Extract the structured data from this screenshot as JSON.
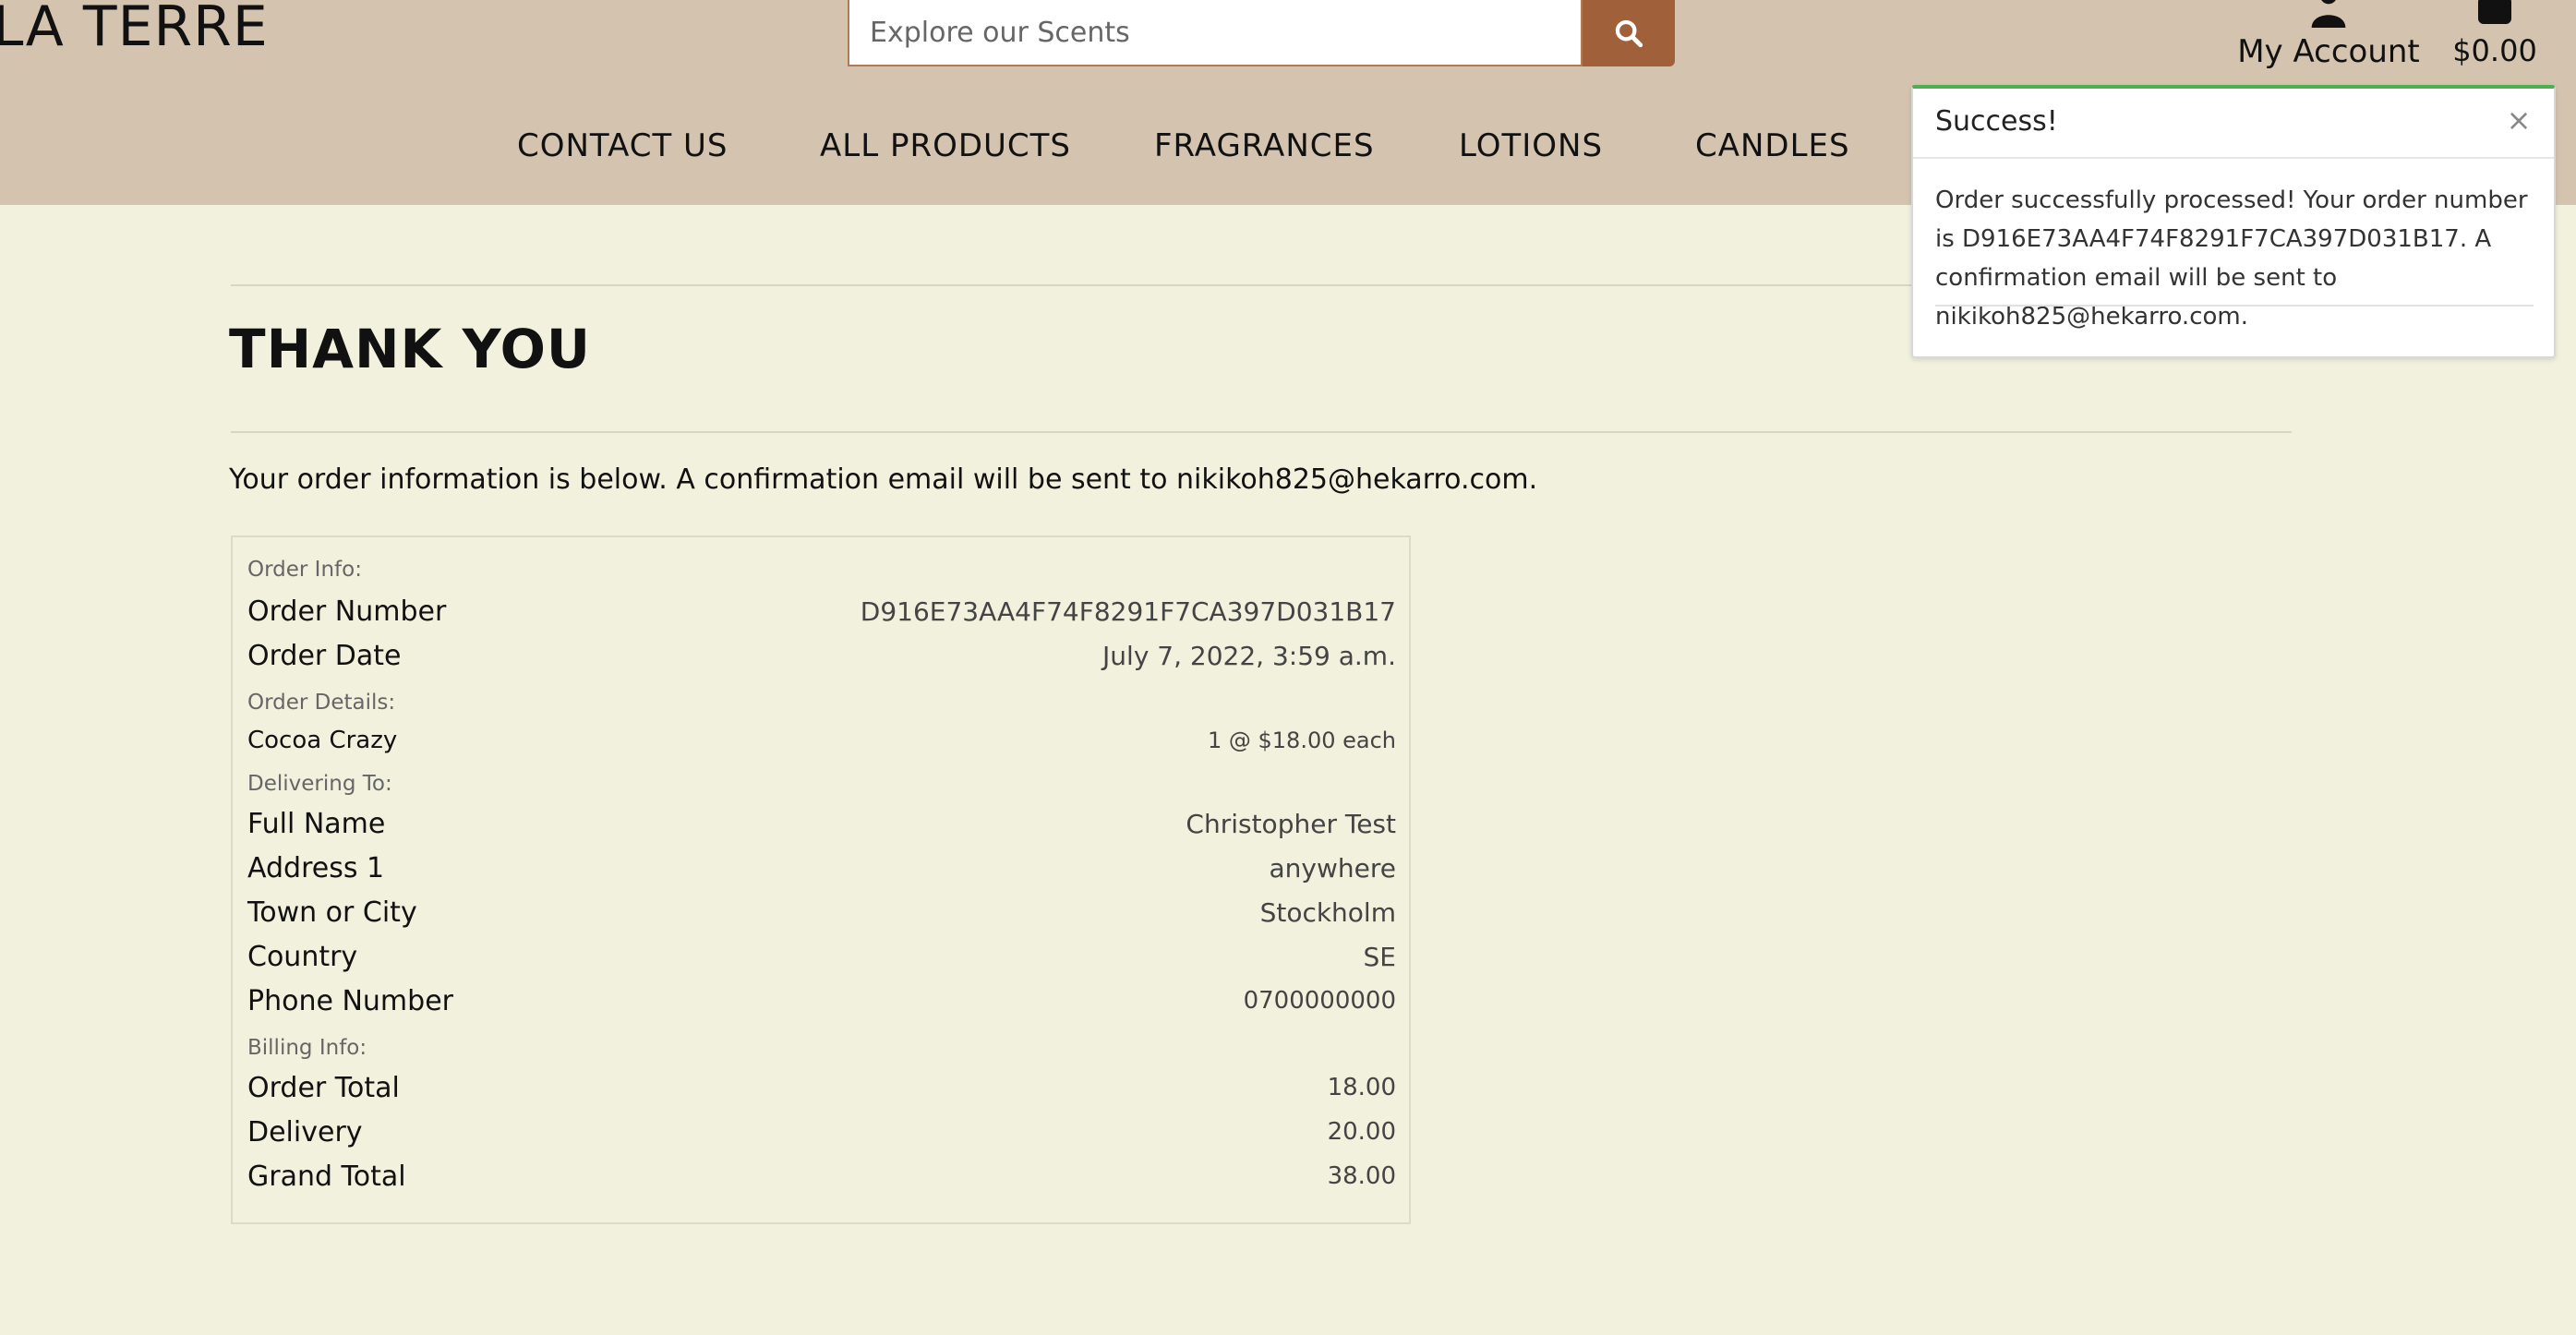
{
  "header": {
    "logo": "LA TERRE",
    "search": {
      "placeholder": "Explore our Scents",
      "button_icon": "search-icon"
    },
    "account": {
      "label": "My Account",
      "icon": "user-icon"
    },
    "bag": {
      "total": "$0.00",
      "icon": "shopping-bag-icon"
    },
    "brand_color": "#d4c4af",
    "accent_color": "#a0603a"
  },
  "nav": {
    "items": [
      {
        "label": "CONTACT US"
      },
      {
        "label": "ALL PRODUCTS"
      },
      {
        "label": "FRAGRANCES"
      },
      {
        "label": "LOTIONS"
      },
      {
        "label": "CANDLES"
      }
    ]
  },
  "main": {
    "title": "THANK YOU",
    "intro": "Your order information is below. A confirmation email will be sent to nikikoh825@hekarro.com.",
    "order_info": {
      "label": "Order Info:",
      "order_number": {
        "key": "Order Number",
        "value": "D916E73AA4F74F8291F7CA397D031B17"
      },
      "order_date": {
        "key": "Order Date",
        "value": "July 7, 2022, 3:59 a.m."
      }
    },
    "order_details": {
      "label": "Order Details:",
      "items": [
        {
          "name": "Cocoa Crazy",
          "qty_price": "1 @ $18.00 each"
        }
      ]
    },
    "delivering_to": {
      "label": "Delivering To:",
      "full_name": {
        "key": "Full Name",
        "value": "Christopher Test"
      },
      "address1": {
        "key": "Address 1",
        "value": "anywhere"
      },
      "town": {
        "key": "Town or City",
        "value": "Stockholm"
      },
      "country": {
        "key": "Country",
        "value": "SE"
      },
      "phone": {
        "key": "Phone Number",
        "value": "0700000000"
      }
    },
    "billing_info": {
      "label": "Billing Info:",
      "order_total": {
        "key": "Order Total",
        "value": "18.00"
      },
      "delivery": {
        "key": "Delivery",
        "value": "20.00"
      },
      "grand_total": {
        "key": "Grand Total",
        "value": "38.00"
      }
    }
  },
  "toast": {
    "title": "Success!",
    "close": "×",
    "message": "Order successfully processed! Your order number is D916E73AA4F74F8291F7CA397D031B17. A confirmation email will be sent to nikikoh825@hekarro.com.",
    "status_color": "#4caf50"
  }
}
